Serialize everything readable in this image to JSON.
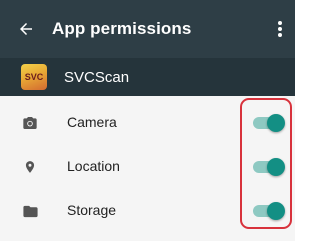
{
  "appbar": {
    "back_icon": "arrow-left-icon",
    "title": "App permissions",
    "more_icon": "more-vert-icon"
  },
  "app": {
    "icon_text": "SVC",
    "name": "SVCScan"
  },
  "permissions": [
    {
      "label": "Camera",
      "icon": "camera-icon",
      "enabled": true
    },
    {
      "label": "Location",
      "icon": "location-pin-icon",
      "enabled": true
    },
    {
      "label": "Storage",
      "icon": "folder-icon",
      "enabled": true
    }
  ],
  "colors": {
    "appbar": "#2e3e46",
    "app_row": "#25343b",
    "toggle_on": "#138f84",
    "toggle_track": "#8ec9c2",
    "highlight": "#d8323c"
  }
}
